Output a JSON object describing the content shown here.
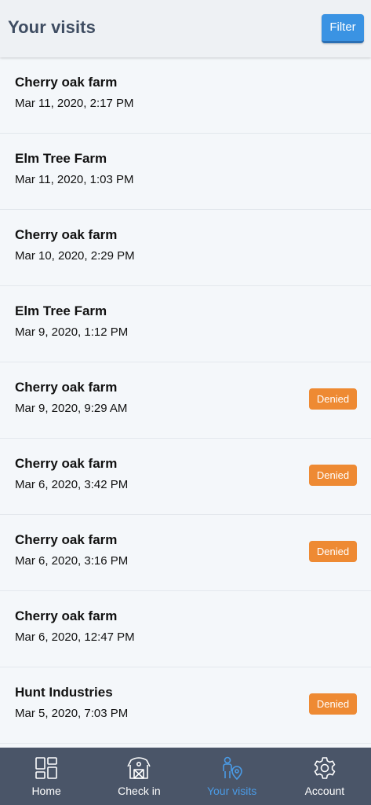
{
  "header": {
    "title": "Your visits",
    "filter_label": "Filter"
  },
  "visits": [
    {
      "name": "Cherry oak farm",
      "date": "Mar 11, 2020, 2:17 PM",
      "status": ""
    },
    {
      "name": "Elm Tree Farm",
      "date": "Mar 11, 2020, 1:03 PM",
      "status": ""
    },
    {
      "name": "Cherry oak farm",
      "date": "Mar 10, 2020, 2:29 PM",
      "status": ""
    },
    {
      "name": "Elm Tree Farm",
      "date": "Mar 9, 2020, 1:12 PM",
      "status": ""
    },
    {
      "name": "Cherry oak farm",
      "date": "Mar 9, 2020, 9:29 AM",
      "status": "Denied"
    },
    {
      "name": "Cherry oak farm",
      "date": "Mar 6, 2020, 3:42 PM",
      "status": "Denied"
    },
    {
      "name": "Cherry oak farm",
      "date": "Mar 6, 2020, 3:16 PM",
      "status": "Denied"
    },
    {
      "name": "Cherry oak farm",
      "date": "Mar 6, 2020, 12:47 PM",
      "status": ""
    },
    {
      "name": "Hunt Industries",
      "date": "Mar 5, 2020, 7:03 PM",
      "status": "Denied"
    }
  ],
  "tabbar": {
    "items": [
      {
        "label": "Home",
        "icon": "home-grid-icon",
        "active": false
      },
      {
        "label": "Check in",
        "icon": "barn-icon",
        "active": false
      },
      {
        "label": "Your visits",
        "icon": "person-location-icon",
        "active": true
      },
      {
        "label": "Account",
        "icon": "gear-icon",
        "active": false
      }
    ]
  },
  "colors": {
    "header_title": "#3f4d62",
    "filter_button": "#3a93e3",
    "denied_badge": "#ee8a33",
    "tabbar_bg": "#4a5568",
    "tab_active": "#4a9be6"
  }
}
